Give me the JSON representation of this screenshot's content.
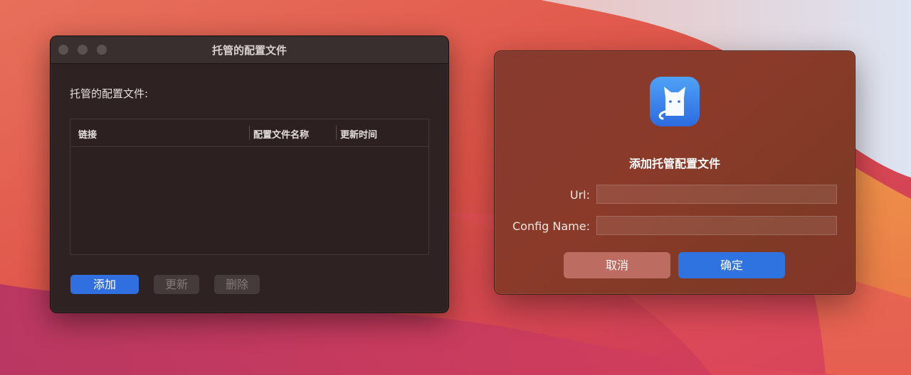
{
  "managed_window": {
    "title": "托管的配置文件",
    "section_label": "托管的配置文件:",
    "columns": [
      "链接",
      "配置文件名称",
      "更新时间"
    ],
    "rows": [],
    "buttons": {
      "add": "添加",
      "update": "更新",
      "delete": "删除"
    }
  },
  "add_dialog": {
    "title": "添加托管配置文件",
    "url_label": "Url:",
    "url_value": "",
    "config_name_label": "Config Name:",
    "config_name_value": "",
    "buttons": {
      "cancel": "取消",
      "ok": "确定"
    }
  },
  "colors": {
    "accent": "#2f6fe0",
    "cancel_button": "#bd6c61",
    "window_bg": "#2e2222"
  },
  "icons": {
    "app": "cat-app-icon"
  }
}
